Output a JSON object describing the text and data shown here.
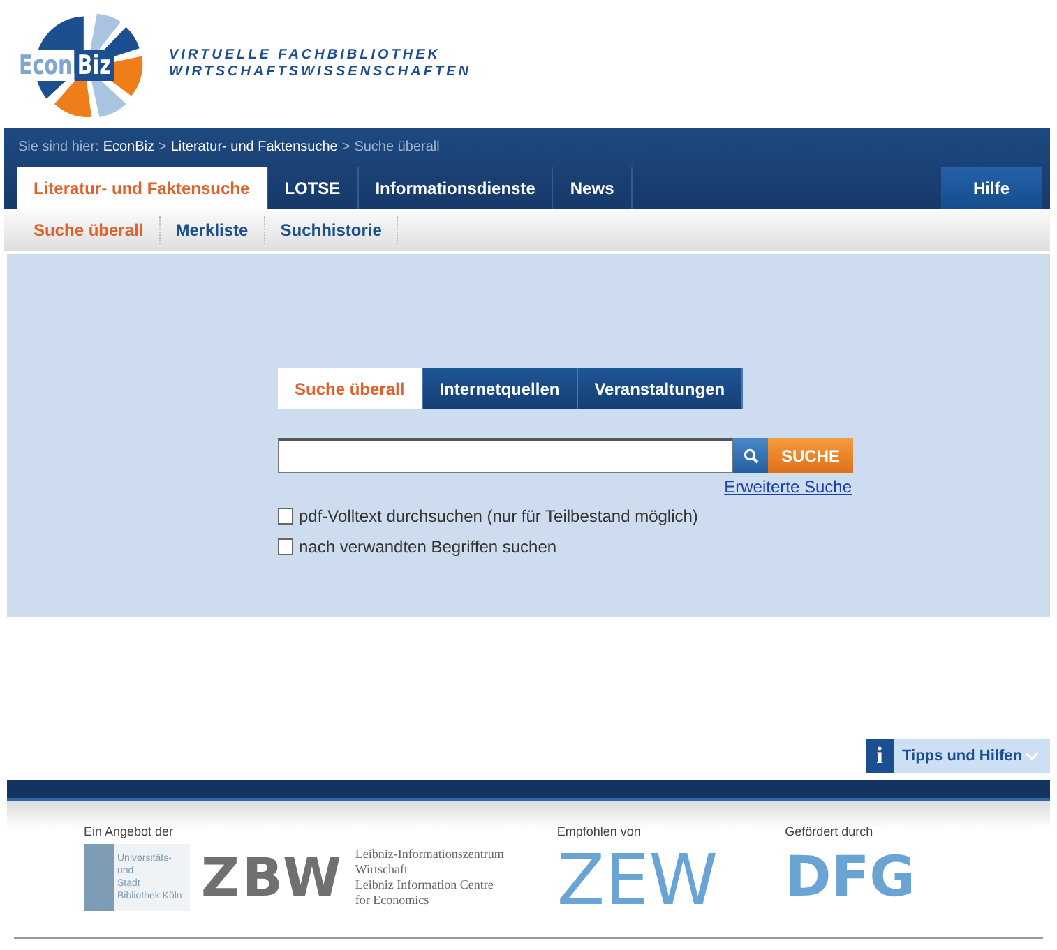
{
  "logo": {
    "word_1": "Econ",
    "word_2": "Biz",
    "tagline_1": "VIRTUELLE FACHBIBLIOTHEK",
    "tagline_2": "WIRTSCHAFTSWISSENSCHAFTEN"
  },
  "breadcrumb": {
    "label": "Sie sind hier:",
    "items": [
      "EconBiz",
      "Literatur- und Faktensuche",
      "Suche überall"
    ],
    "separator": ">"
  },
  "main_tabs": [
    {
      "label": "Literatur- und Faktensuche",
      "selected": true
    },
    {
      "label": "LOTSE",
      "selected": false
    },
    {
      "label": "Informationsdienste",
      "selected": false
    },
    {
      "label": "News",
      "selected": false
    }
  ],
  "help_tab": {
    "label": "Hilfe"
  },
  "sub_tabs": [
    {
      "label": "Suche überall",
      "selected": true
    },
    {
      "label": "Merkliste",
      "selected": false
    },
    {
      "label": "Suchhistorie",
      "selected": false
    }
  ],
  "search_tabs": [
    {
      "label": "Suche überall",
      "selected": true
    },
    {
      "label": "Internetquellen",
      "selected": false
    },
    {
      "label": "Veranstaltungen",
      "selected": false
    }
  ],
  "search": {
    "button": "SUCHE",
    "advanced_link": "Erweiterte Suche"
  },
  "options": [
    {
      "label": "pdf-Volltext durchsuchen (nur für Teilbestand möglich)",
      "checked": false
    },
    {
      "label": "nach verwandten Begriffen suchen",
      "checked": false
    }
  ],
  "tips": {
    "icon": "i",
    "label": "Tipps und Hilfen"
  },
  "footer": {
    "provided_by": {
      "heading": "Ein Angebot der",
      "usb_lines": [
        "Universitäts- und",
        "Stadt",
        "Bibliothek Köln"
      ],
      "zbw_mark": "ZBW",
      "zbw_lines": [
        "Leibniz-Informationszentrum",
        "Wirtschaft",
        "Leibniz Information Centre",
        "for Economics"
      ]
    },
    "recommended_by": {
      "heading": "Empfohlen von",
      "mark": "ZEW"
    },
    "funded_by": {
      "heading": "Gefördert durch",
      "mark": "DFG"
    }
  }
}
